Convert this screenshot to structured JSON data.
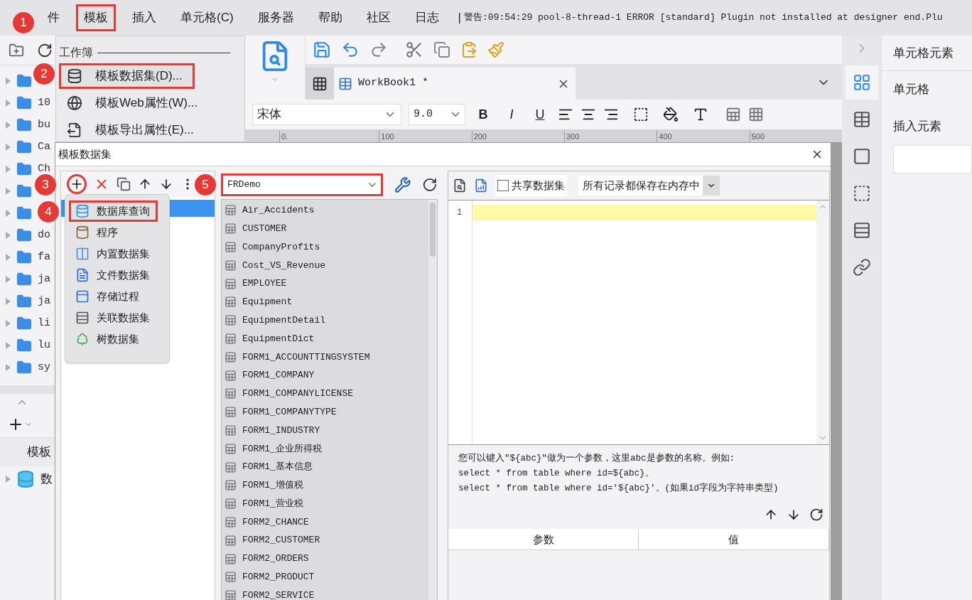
{
  "menu_bar": {
    "items": [
      {
        "label": "件",
        "highlighted": false
      },
      {
        "label": "模板",
        "highlighted": true
      },
      {
        "label": "插入",
        "highlighted": false
      },
      {
        "label": "单元格(C)",
        "highlighted": false
      },
      {
        "label": "服务器",
        "highlighted": false
      },
      {
        "label": "帮助",
        "highlighted": false
      },
      {
        "label": "社区",
        "highlighted": false
      },
      {
        "label": "日志",
        "highlighted": false
      }
    ],
    "separator": "|",
    "log_message": "警告:09:54:29 pool-8-thread-1 ERROR [standard] Plugin not installed at designer end.Plu"
  },
  "template_menu": {
    "section": "工作簿",
    "items": [
      {
        "label": "模板数据集(D)...",
        "highlighted": true
      },
      {
        "label": "模板Web属性(W)...",
        "highlighted": false
      },
      {
        "label": "模板导出属性(E)...",
        "highlighted": false
      }
    ]
  },
  "file_tree": {
    "items": [
      {
        "kind": "folder"
      },
      {
        "kind": "folder",
        "label": "10"
      },
      {
        "kind": "folder",
        "label": "bu"
      },
      {
        "kind": "folder",
        "label": "Ca"
      },
      {
        "kind": "folder",
        "label": "Ch"
      },
      {
        "kind": "folder"
      },
      {
        "kind": "folder"
      },
      {
        "kind": "folder",
        "label": "do"
      },
      {
        "kind": "folder",
        "label": "fa"
      },
      {
        "kind": "folder",
        "label": "ja"
      },
      {
        "kind": "folder",
        "label": "ja"
      },
      {
        "kind": "folder",
        "label": "li"
      },
      {
        "kind": "folder",
        "label": "lu"
      },
      {
        "kind": "folder",
        "label": "sy"
      }
    ]
  },
  "template_panel": {
    "heading": "模板",
    "items": [
      {
        "label": "数"
      }
    ]
  },
  "designer": {
    "tab": "WorkBook1 *",
    "font": "宋体",
    "font_size": "9.0",
    "style_buttons": [
      "B",
      "I",
      "U"
    ],
    "ruler": [
      "0.",
      "100",
      "200",
      "300",
      "400",
      "500"
    ]
  },
  "sidebar_tabs": [
    {
      "selected": true
    },
    {
      "selected": false
    },
    {
      "selected": false
    },
    {
      "selected": false
    },
    {
      "selected": false
    },
    {
      "selected": false
    }
  ],
  "properties": {
    "title": "单元格元素",
    "labels": [
      "单元格",
      "插入元素"
    ]
  },
  "dialog": {
    "title": "模板数据集",
    "add_button_highlighted": true,
    "datasets": [
      {
        "selected": true
      }
    ],
    "add_menu": [
      {
        "label": "数据库查询",
        "highlighted": true
      },
      {
        "label": "程序",
        "highlighted": false
      },
      {
        "label": "内置数据集",
        "highlighted": false
      },
      {
        "label": "文件数据集",
        "highlighted": false
      },
      {
        "label": "存储过程",
        "highlighted": false
      },
      {
        "label": "关联数据集",
        "highlighted": false
      },
      {
        "label": "树数据集",
        "highlighted": false
      }
    ],
    "connection": {
      "value": "FRDemo",
      "highlighted": true
    },
    "tables": [
      "Air_Accidents",
      "CUSTOMER",
      "CompanyProfits",
      "Cost_VS_Revenue",
      "EMPLOYEE",
      "Equipment",
      "EquipmentDetail",
      "EquipmentDict",
      "FORM1_ACCOUNTTINGSYSTEM",
      "FORM1_COMPANY",
      "FORM1_COMPANYLICENSE",
      "FORM1_COMPANYTYPE",
      "FORM1_INDUSTRY",
      "FORM1_企业所得税",
      "FORM1_基本信息",
      "FORM1_增值税",
      "FORM1_营业税",
      "FORM2_CHANCE",
      "FORM2_CUSTOMER",
      "FORM2_ORDERS",
      "FORM2_PRODUCT",
      "FORM2_SERVICE"
    ],
    "share_checkbox": {
      "label": "共享数据集",
      "checked": false
    },
    "storage_select": "所有记录都保存在内存中",
    "editor": {
      "line_numbers": [
        "1"
      ]
    },
    "hint_lines": [
      "您可以键入\"${abc}\"做为一个参数，这里abc是参数的名称。例如:",
      "select * from table where id=${abc}。",
      "select * from table where id='${abc}'。(如果id字段为字符串类型)"
    ],
    "param_columns": [
      "参数",
      "值"
    ]
  },
  "step_badges": [
    "1",
    "2",
    "3",
    "4",
    "5"
  ]
}
